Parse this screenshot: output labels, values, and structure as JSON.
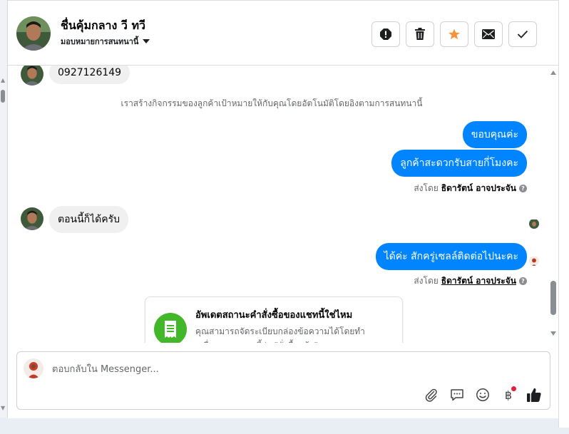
{
  "header": {
    "contact_name": "ชื่นคุ้มกลาง วี ทวี",
    "assign_label": "มอบหมายการสนทนานี้",
    "actions": [
      {
        "name": "spam-button",
        "icon": "alert-icon"
      },
      {
        "name": "delete-button",
        "icon": "trash-icon"
      },
      {
        "name": "star-button",
        "icon": "star-icon"
      },
      {
        "name": "mark-unread-button",
        "icon": "envelope-icon"
      },
      {
        "name": "done-button",
        "icon": "check-icon"
      }
    ]
  },
  "messages": {
    "phone": "0927126149",
    "system_note": "เราสร้างกิจกรรมของลูกค้าเป้าหมายให้กับคุณโดยอัตโนมัติโดยอิงตามการสนทนานี้",
    "out_1": "ขอบคุณค่ะ",
    "out_2": "ลูกค้าสะดวกรับสายกี่โมงคะ",
    "sent_by_label": "ส่งโดย",
    "agent_name": "ธิดารัตน์ อาจประจัน",
    "in_1": "ตอนนี้ก็ได้ครับ",
    "out_3": "ได้ค่ะ สักครู่เซลล์ติดต่อไปนะคะ"
  },
  "card": {
    "title": "อัพเดตสถานะคำสั่งซื้อของแชทนี้ใช่ไหม",
    "body": "คุณสามารถจัดระเบียบกล่องข้อความได้โดยทำเครื่องหมายแชทนี้ว่า \"สั่งซื้อแล้ว\""
  },
  "composer": {
    "placeholder": "ตอบกลับใน Messenger...",
    "baht_symbol": "฿"
  },
  "colors": {
    "accent": "#0084ff",
    "star": "#f7923b",
    "card_icon": "#42b72a",
    "badge": "#e41e3f"
  }
}
